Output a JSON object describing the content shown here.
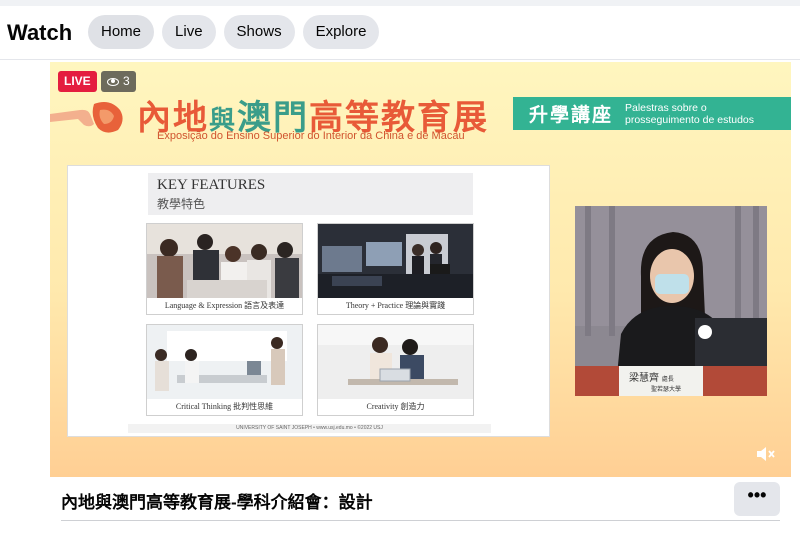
{
  "header": {
    "brand": "Watch",
    "nav": [
      {
        "label": "Home",
        "active": true
      },
      {
        "label": "Live",
        "active": false
      },
      {
        "label": "Shows",
        "active": false
      },
      {
        "label": "Explore",
        "active": false
      }
    ]
  },
  "player": {
    "live_label": "LIVE",
    "viewer_count": "3",
    "banner": {
      "title_part1": "內地",
      "title_small": "與",
      "title_part2": "澳門",
      "title_part3": "高等教育展",
      "subtitle": "Exposição do Ensino Superior do Interior da China e de Macau",
      "seminar_zh": "升學講座",
      "seminar_pt_line1": "Palestras sobre o",
      "seminar_pt_line2": "prosseguimento de estudos"
    },
    "slide": {
      "title": "KEY FEATURES",
      "subtitle": "教學特色",
      "cards": [
        {
          "caption": "Language & Expression 語言及表達"
        },
        {
          "caption": "Theory + Practice 理論與實踐"
        },
        {
          "caption": "Critical Thinking 批判性思維"
        },
        {
          "caption": "Creativity 創造力"
        }
      ],
      "footer": "UNIVERSITY OF SAINT JOSEPH • www.usj.edu.mo • ©2022 USJ"
    },
    "presenter": {
      "nameplate_name": "梁慧齊",
      "nameplate_role": "處長",
      "nameplate_org": "聖若瑟大學"
    }
  },
  "video_title": "內地與澳門高等教育展-學科介紹會：設計",
  "more_label": "•••",
  "colors": {
    "live_red": "#e41e3f",
    "seminar_green": "#33b393",
    "expo_orange": "#e85a38"
  }
}
